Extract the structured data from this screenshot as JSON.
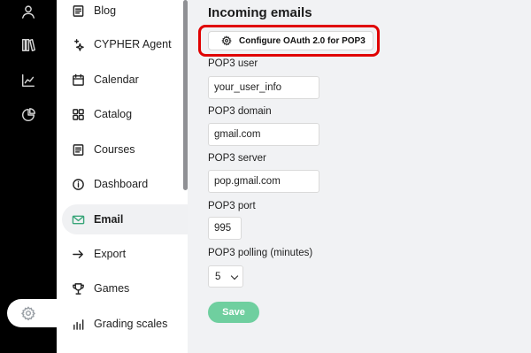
{
  "rail": {
    "icons": [
      "user-icon",
      "library-icon",
      "analytics-icon",
      "pie-chart-icon",
      "settings-icon"
    ]
  },
  "menu": {
    "items": [
      {
        "label": "Blog",
        "icon": "document-list-icon"
      },
      {
        "label": "CYPHER Agent",
        "icon": "sparkle-icon"
      },
      {
        "label": "Calendar",
        "icon": "calendar-icon"
      },
      {
        "label": "Catalog",
        "icon": "grid-icon"
      },
      {
        "label": "Courses",
        "icon": "document-list-icon"
      },
      {
        "label": "Dashboard",
        "icon": "info-icon"
      },
      {
        "label": "Email",
        "icon": "mail-icon",
        "active": true
      },
      {
        "label": "Export",
        "icon": "arrow-right-icon"
      },
      {
        "label": "Games",
        "icon": "trophy-icon"
      },
      {
        "label": "Grading scales",
        "icon": "bar-chart-icon"
      }
    ]
  },
  "main": {
    "title": "Incoming emails",
    "oauth_button": "Configure OAuth 2.0 for POP3",
    "fields": {
      "user": {
        "label": "POP3 user",
        "value": "your_user_info"
      },
      "domain": {
        "label": "POP3 domain",
        "value": "gmail.com"
      },
      "server": {
        "label": "POP3 server",
        "value": "pop.gmail.com"
      },
      "port": {
        "label": "POP3 port",
        "value": "995"
      },
      "polling": {
        "label": "POP3 polling (minutes)",
        "value": "5"
      }
    },
    "save_label": "Save"
  },
  "colors": {
    "accent": "#6fcf9f",
    "highlight": "#e00000",
    "rail": "#000000"
  }
}
